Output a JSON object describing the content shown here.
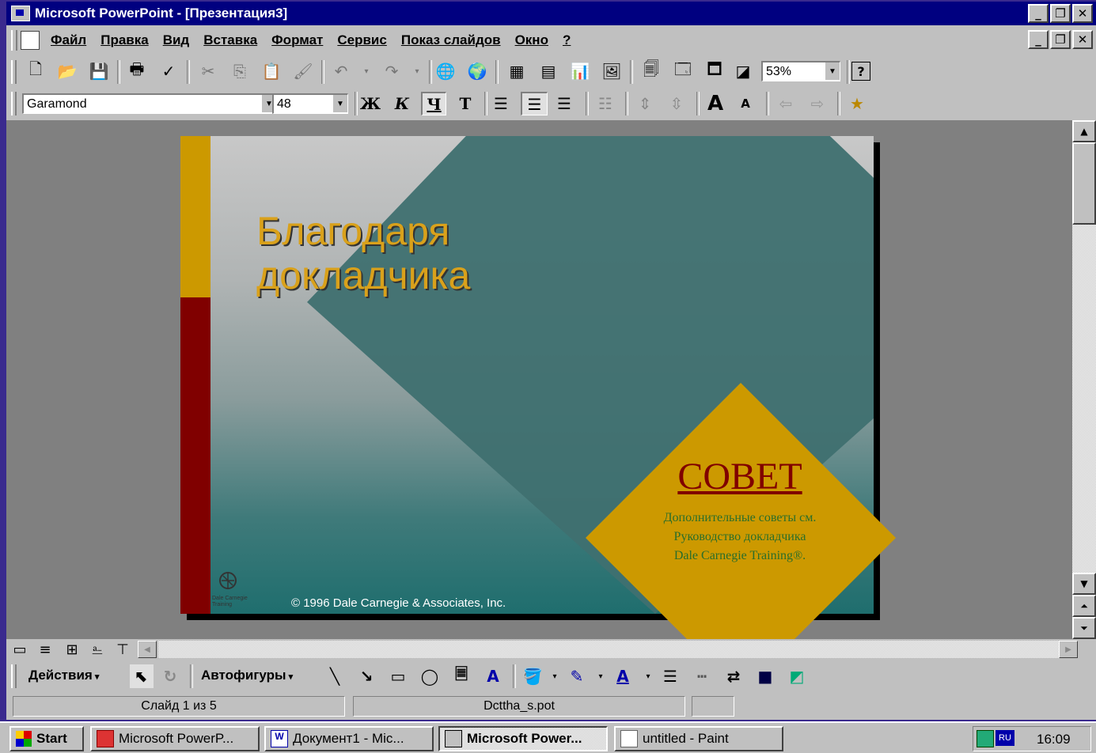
{
  "window": {
    "title": "Microsoft PowerPoint - [Презентация3]",
    "min": "_",
    "restore": "🗗",
    "close": "✕"
  },
  "menu": {
    "items": [
      "Файл",
      "Правка",
      "Вид",
      "Вставка",
      "Формат",
      "Сервис",
      "Показ слайдов",
      "Окно",
      "?"
    ]
  },
  "toolbar": {
    "zoom": "53%",
    "font": "Garamond",
    "size": "48",
    "bold": "Ж",
    "italic": "К",
    "underline": "Ч",
    "shadow": "Т",
    "grow_font": "A",
    "shrink_font": "A"
  },
  "slide": {
    "title_line1": "Благодаря",
    "title_line2": "докладчика",
    "tip_title": "СОВЕТ",
    "tip_line1": "Дополнительные советы см.",
    "tip_line2": "Руководство докладчика",
    "tip_line3": "Dale Carnegie Training®.",
    "copyright": "© 1996 Dale Carnegie & Associates, Inc.",
    "logo_text_1": "Dale Carnegie",
    "logo_text_2": "Training",
    "colors": {
      "gold": "#cc9900",
      "red": "#800000",
      "teal": "#3a6e6e"
    }
  },
  "drawing": {
    "actions": "Действия",
    "autoshapes": "Автофигуры"
  },
  "status": {
    "slide": "Слайд 1 из 5",
    "template": "Dcttha_s.pot",
    "extra": ""
  },
  "taskbar": {
    "start": "Start",
    "tasks": [
      "Microsoft PowerP...",
      "Документ1 - Mic...",
      "Microsoft Power...",
      "untitled - Paint"
    ],
    "clock": "16:09"
  }
}
